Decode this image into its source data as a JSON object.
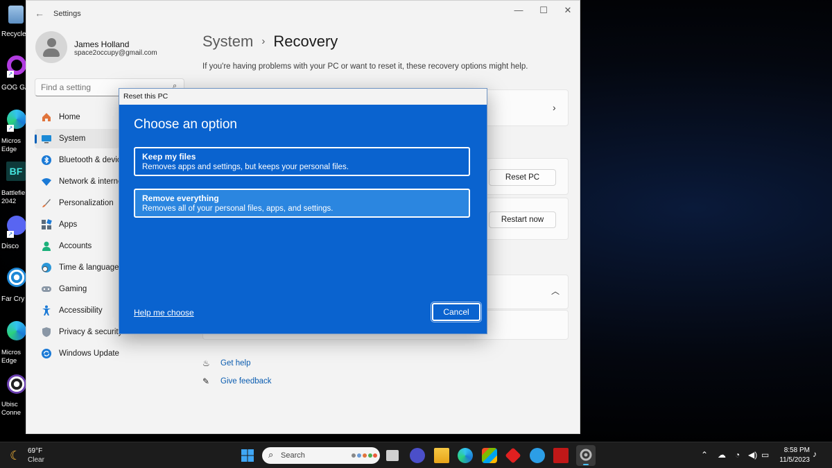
{
  "desktop": {
    "icons": [
      {
        "label": "Recycle",
        "icon": "recycle-bin-icon"
      },
      {
        "label": "GOG GA",
        "icon": "gog-galaxy-icon"
      },
      {
        "label": "Micros Edge",
        "icon": "edge-icon"
      },
      {
        "label": "Battlefie 2042",
        "icon": "battlefield-icon"
      },
      {
        "label": "Disco",
        "icon": "discord-icon"
      },
      {
        "label": "Far Cry",
        "icon": "ubisoft-icon"
      },
      {
        "label": "Micros Edge",
        "icon": "edge-icon"
      },
      {
        "label": "Ubisc Conne",
        "icon": "ubisoft-icon"
      }
    ]
  },
  "window": {
    "title": "Settings",
    "controls": {
      "minimize": "—",
      "maximize": "☐",
      "close": "✕"
    }
  },
  "profile": {
    "name": "James Holland",
    "email": "space2occupy@gmail.com"
  },
  "search": {
    "placeholder": "Find a setting"
  },
  "sidebar": {
    "items": [
      {
        "label": "Home",
        "icon": "home-icon"
      },
      {
        "label": "System",
        "icon": "system-icon",
        "active": true
      },
      {
        "label": "Bluetooth & devic",
        "icon": "bluetooth-icon"
      },
      {
        "label": "Network & interne",
        "icon": "wifi-icon"
      },
      {
        "label": "Personalization",
        "icon": "brush-icon"
      },
      {
        "label": "Apps",
        "icon": "apps-icon"
      },
      {
        "label": "Accounts",
        "icon": "accounts-icon"
      },
      {
        "label": "Time & language",
        "icon": "globe-clock-icon"
      },
      {
        "label": "Gaming",
        "icon": "gamepad-icon"
      },
      {
        "label": "Accessibility",
        "icon": "accessibility-icon"
      },
      {
        "label": "Privacy & security",
        "icon": "shield-icon"
      },
      {
        "label": "Windows Update",
        "icon": "update-icon"
      }
    ]
  },
  "page": {
    "breadcrumb_parent": "System",
    "breadcrumb_sep": "›",
    "breadcrumb_current": "Recovery",
    "subtitle": "If you're having problems with your PC or want to reset it, these recovery options might help.",
    "reset_pc_button": "Reset PC",
    "restart_now_button": "Restart now",
    "links": [
      {
        "label": "Get help",
        "icon": "help-icon"
      },
      {
        "label": "Give feedback",
        "icon": "feedback-icon"
      }
    ]
  },
  "dialog": {
    "title": "Reset this PC",
    "heading": "Choose an option",
    "options": [
      {
        "title": "Keep my files",
        "description": "Removes apps and settings, but keeps your personal files."
      },
      {
        "title": "Remove everything",
        "description": "Removes all of your personal files, apps, and settings."
      }
    ],
    "help_link": "Help me choose",
    "cancel_button": "Cancel"
  },
  "taskbar": {
    "weather_temp": "69°F",
    "weather_desc": "Clear",
    "search_label": "Search",
    "time": "8:58 PM",
    "date": "11/5/2023",
    "colors": {
      "background": "#1c1c1c",
      "accent": "#0a63cf"
    }
  }
}
